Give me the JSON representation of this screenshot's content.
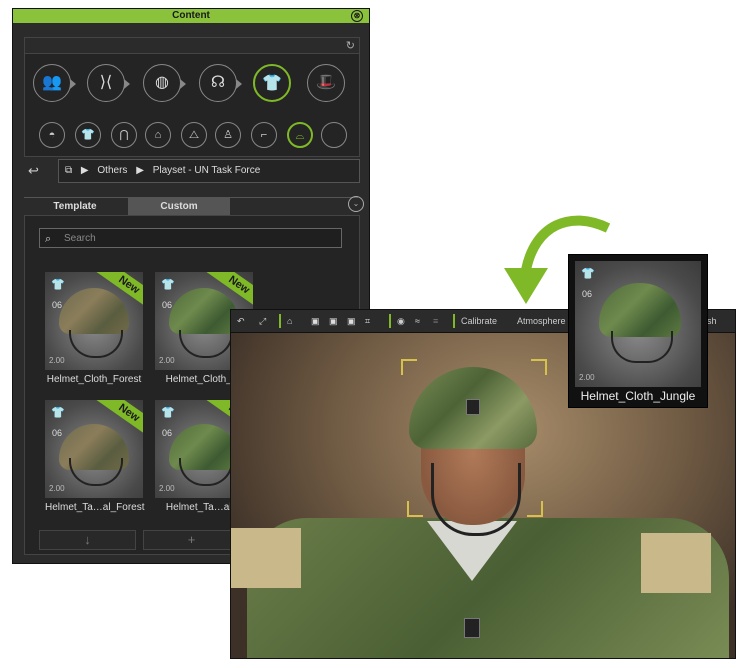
{
  "panel": {
    "title": "Content",
    "close_glyph": "⊗",
    "refresh_glyph": "↻",
    "category_icons": [
      {
        "name": "actor-icon",
        "glyph": "👥"
      },
      {
        "name": "motion-icon",
        "glyph": "⟩⟨"
      },
      {
        "name": "material-icon",
        "glyph": "◍"
      },
      {
        "name": "head-icon",
        "glyph": "☊"
      },
      {
        "name": "cloth-icon",
        "glyph": "👕"
      },
      {
        "name": "accessory-icon",
        "glyph": "🎩"
      }
    ],
    "sub_icons": [
      {
        "name": "hair-icon",
        "glyph": "◓"
      },
      {
        "name": "shirt-icon",
        "glyph": "👕"
      },
      {
        "name": "pants-icon",
        "glyph": "⋂"
      },
      {
        "name": "skirt-icon",
        "glyph": "⌂"
      },
      {
        "name": "jacket-icon",
        "glyph": "⧍"
      },
      {
        "name": "dress-icon",
        "glyph": "♙"
      },
      {
        "name": "shoe-icon",
        "glyph": "⌐"
      },
      {
        "name": "hanger-icon",
        "glyph": "⌓"
      },
      {
        "name": "empty-slot-icon",
        "glyph": ""
      }
    ],
    "breadcrumb": {
      "root_glyph": "⧉",
      "arrow": "▶",
      "level1": "Others",
      "level2": "Playset - UN Task Force"
    },
    "back_glyph": "↩",
    "tabs": {
      "template": "Template",
      "custom": "Custom",
      "more_glyph": "⌄"
    },
    "search": {
      "placeholder": "Search",
      "icon_glyph": "⌕"
    },
    "items": [
      {
        "label": "Helmet_Cloth_Forest",
        "version": "2.00",
        "num": "06",
        "new": "New",
        "shirt": "👕"
      },
      {
        "label": "Helmet_Cloth_Ju",
        "version": "2.00",
        "num": "06",
        "new": "New",
        "shirt": "👕"
      },
      {
        "label": "Helmet_Ta…al_Forest",
        "version": "2.00",
        "num": "06",
        "new": "New",
        "shirt": "👕"
      },
      {
        "label": "Helmet_Ta…al_J",
        "version": "2.00",
        "num": "06",
        "new": "New",
        "shirt": "👕"
      }
    ],
    "footer": {
      "down_glyph": "↓",
      "add_glyph": "+"
    }
  },
  "viewport": {
    "toolbar": {
      "undo_glyph": "↶",
      "fit_glyph": "⤢",
      "home_glyph": "⌂",
      "calibrate": "Calibrate",
      "atmosphere": "Atmosphere",
      "eye_glyph": "◉",
      "trail_text": "ish"
    }
  },
  "popout": {
    "label": "Helmet_Cloth_Jungle",
    "version": "2.00",
    "num": "06",
    "shirt": "👕"
  },
  "colors": {
    "accent": "#7fb928",
    "panel_bg": "#2b2b2b"
  }
}
